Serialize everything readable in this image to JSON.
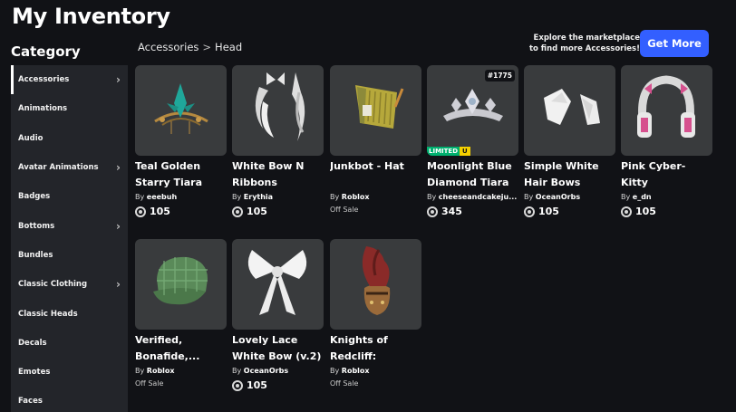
{
  "page": {
    "title": "My Inventory"
  },
  "sidebar": {
    "heading": "Category",
    "items": [
      {
        "label": "Accessories",
        "chevron": true,
        "active": true
      },
      {
        "label": "Animations",
        "chevron": false
      },
      {
        "label": "Audio",
        "chevron": false
      },
      {
        "label": "Avatar Animations",
        "chevron": true
      },
      {
        "label": "Badges",
        "chevron": false
      },
      {
        "label": "Bottoms",
        "chevron": true
      },
      {
        "label": "Bundles",
        "chevron": false
      },
      {
        "label": "Classic Clothing",
        "chevron": true
      },
      {
        "label": "Classic Heads",
        "chevron": false
      },
      {
        "label": "Decals",
        "chevron": false
      },
      {
        "label": "Emotes",
        "chevron": false
      },
      {
        "label": "Faces",
        "chevron": false
      }
    ]
  },
  "breadcrumb": {
    "parent": "Accessories",
    "separator": ">",
    "current": "Head"
  },
  "promo": {
    "line1": "Explore the marketplace",
    "line2": "to find more Accessories!",
    "button": "Get More"
  },
  "colors": {
    "accent": "#335fff",
    "card_bg": "#393b3d",
    "page_bg": "#111216",
    "sidebar_bg": "#23252a",
    "limited_green": "#00b06f",
    "limited_yellow": "#f5d000"
  },
  "items": [
    {
      "name": "Teal Golden\nStarry Tiara",
      "by": "By",
      "creator": "eeebuh",
      "price": "105",
      "icon": "tiara-icon"
    },
    {
      "name": "White Bow N\nRibbons",
      "by": "By",
      "creator": "Erythia",
      "price": "105",
      "icon": "ribbons-icon"
    },
    {
      "name": "Junkbot - Hat",
      "by": "By",
      "creator": "Roblox",
      "status": "Off Sale",
      "icon": "junkbot-hat-icon"
    },
    {
      "name": "Moonlight Blue\nDiamond Tiara",
      "by": "By",
      "creator": "cheeseandcakeju...",
      "price": "345",
      "serial": "#1775",
      "limited": "LIMITED",
      "limited_u": "U",
      "icon": "diamond-tiara-icon"
    },
    {
      "name": "Simple White\nHair Bows",
      "by": "By",
      "creator": "OceanOrbs",
      "price": "105",
      "icon": "hair-bows-icon"
    },
    {
      "name": "Pink Cyber-Kitty\nMecha...",
      "by": "By",
      "creator": "e_dn",
      "price": "105",
      "icon": "cyber-headphones-icon"
    },
    {
      "name": "Verified,\nBonafide,...",
      "by": "By",
      "creator": "Roblox",
      "status": "Off Sale",
      "icon": "plaid-cap-icon"
    },
    {
      "name": "Lovely Lace\nWhite Bow (v.2)",
      "by": "By",
      "creator": "OceanOrbs",
      "price": "105",
      "icon": "lace-bow-icon"
    },
    {
      "name": "Knights of\nRedcliff: Paladi...",
      "by": "By",
      "creator": "Roblox",
      "status": "Off Sale",
      "icon": "knight-helmet-icon"
    }
  ]
}
